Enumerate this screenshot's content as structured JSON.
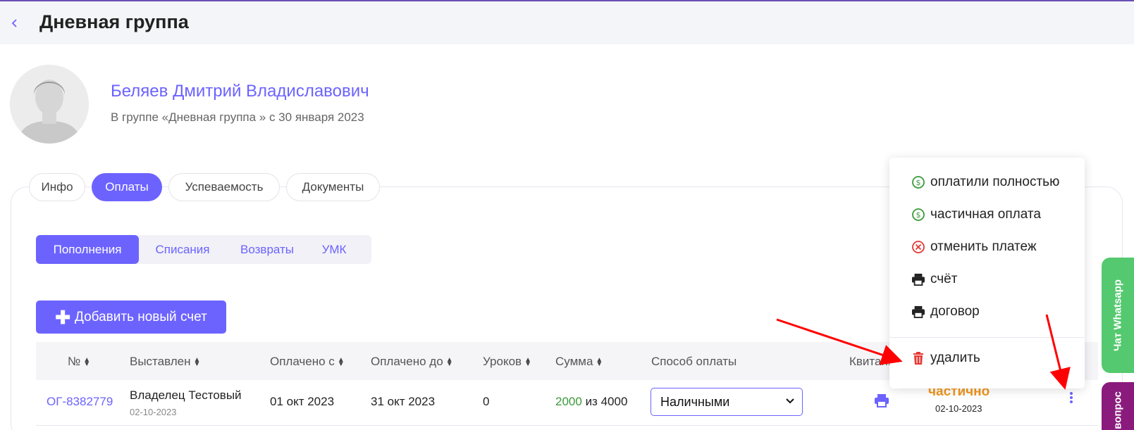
{
  "header": {
    "back_icon": "chevron-left-icon",
    "title": "Дневная группа"
  },
  "profile": {
    "name": "Беляев Дмитрий Владиславович",
    "subtitle": "В группе «Дневная группа » с 30 января 2023"
  },
  "tabs": [
    {
      "label": "Инфо",
      "active": false
    },
    {
      "label": "Оплаты",
      "active": true
    },
    {
      "label": "Успеваемость",
      "active": false
    },
    {
      "label": "Документы",
      "active": false
    }
  ],
  "subtabs": [
    {
      "label": "Пополнения",
      "active": true
    },
    {
      "label": "Списания",
      "active": false
    },
    {
      "label": "Возвраты",
      "active": false
    },
    {
      "label": "УМК",
      "active": false
    }
  ],
  "add_button": {
    "label": "Добавить новый счет",
    "icon": "plus-icon"
  },
  "table": {
    "columns": [
      "№",
      "Выставлен",
      "Оплачено с",
      "Оплачено до",
      "Уроков",
      "Сумма",
      "Способ оплаты",
      "Квитанц"
    ],
    "rows": [
      {
        "number": "ОГ-8382779",
        "issuer": "Владелец Тестовый",
        "issued_date": "02-10-2023",
        "paid_from": "01 окт 2023",
        "paid_to": "31 окт 2023",
        "lessons": "0",
        "paid_amount": "2000",
        "amount_of": "из",
        "total_amount": "4000",
        "payment_method": "Наличными",
        "status": "частично",
        "status_date": "02-10-2023"
      }
    ]
  },
  "context_menu": {
    "items": [
      {
        "label": "оплатили полностью",
        "icon": "dollar-circle-icon",
        "color": "#3a9a3a"
      },
      {
        "label": "частичная оплата",
        "icon": "dollar-circle-icon",
        "color": "#3a9a3a"
      },
      {
        "label": "отменить платеж",
        "icon": "cancel-circle-icon",
        "color": "#e53935"
      },
      {
        "label": "счёт",
        "icon": "printer-icon",
        "color": "#222222"
      },
      {
        "label": "договор",
        "icon": "printer-icon",
        "color": "#222222"
      },
      {
        "label": "удалить",
        "icon": "trash-icon",
        "color": "#e53935"
      }
    ]
  },
  "side_tabs": {
    "whatsapp": "Чат Whatsapp",
    "question": "вопрос"
  },
  "colors": {
    "accent": "#6c63ff",
    "status_partial": "#f0961f",
    "paid_green": "#3a9a3a",
    "annotation_arrow": "#ff0000"
  }
}
